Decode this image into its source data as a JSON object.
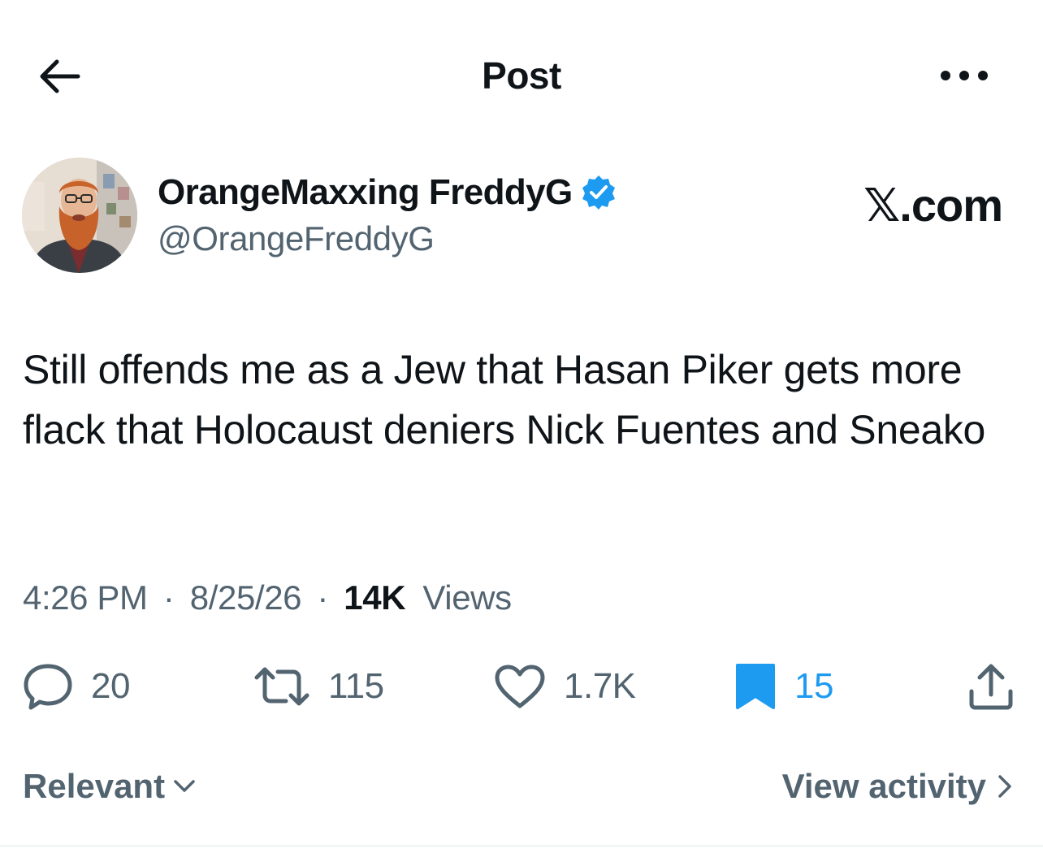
{
  "header": {
    "back_icon": "arrow-left-icon",
    "title": "Post",
    "more_icon": "more-horizontal-icon"
  },
  "author": {
    "display_name": "OrangeMaxxing FreddyG",
    "verified": true,
    "verified_color": "#1d9bf0",
    "handle": "@OrangeFreddyG"
  },
  "watermark": "𝕏.com",
  "tweet": {
    "text": "Still offends me as a Jew that Hasan Piker gets more flack that Holocaust deniers Nick Fuentes and Sneako",
    "time": "4:26 PM",
    "date": "8/25/26",
    "separator": "·",
    "views_count": "14K",
    "views_label": "Views"
  },
  "actions": {
    "reply_count": "20",
    "repost_count": "115",
    "like_count": "1.7K",
    "bookmark_count": "15",
    "bookmarked": true,
    "accent_color": "#1d9bf0",
    "muted_color": "#536471"
  },
  "footer": {
    "sort_label": "Relevant",
    "view_activity_label": "View activity"
  }
}
